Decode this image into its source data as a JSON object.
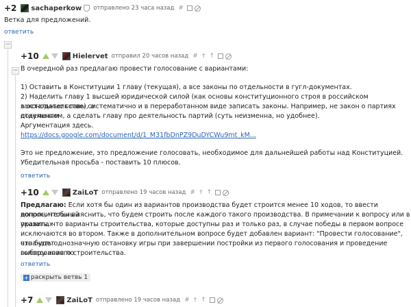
{
  "comments": [
    {
      "score": "+2",
      "author": "sachaperkow",
      "meta": "отправлено 23 часа назад",
      "body": "Ветка для предложений.",
      "reply": "ответить"
    },
    {
      "score": "+10",
      "author": "Hielervet",
      "meta": "отправил 20 часов назад",
      "lines": [
        "В очередной раз предлагаю провести голосование с вариантами:",
        "1) Оставить в Конституции 1 главу (текущая), а все законы по отдельности в гугл-документах.",
        "2) Наделить главу 1 высшей юридической силой (как основы конституционного строя в российском законодательстве), а",
        "в остальные главы систематично и в переработанном виде записать законы. Например, не закон о партиях отдельным",
        "документом, а сделать главу про деятельность партий (суть неизменна, но удобнее).",
        "Аргументация здесь.",
        "Это не предложение, это предложение голосовать, необходимое для дальнейшей работы над Конституцией.",
        "Убедительная просьба - поставить 10 плюсов."
      ],
      "link": "https://docs.google.com/document/d/1_M31fbDnPZ9DuDYCWu9mt_kM...",
      "reply": "ответить"
    },
    {
      "score": "+10",
      "author": "ZaiLoT",
      "meta": "отправлено 19 часов назад",
      "lead": "Предлагаю:",
      "lines": [
        " Если хотя бы один из вариантов производства будет строится менее 10 ходов, то ввести дополнительный",
        "вопрос, чтобы выяснить, что будем строить после каждого такого производства. В примечании к вопросу или в правилах",
        "указать, что варианты строительства, которые доступны раз и только раз, в случае победы в первом вопросе",
        "исключаются во втором. Также в дополнительном вопросе будет добавлен вариант: \"Провести голосование\", что будет",
        "означать однозначную остановку игры при завершении постройки из первого голосования и проведение голосования по",
        "выбору нового строительства."
      ],
      "reply": "ответить",
      "expand": "раскрыть ветвь 1"
    },
    {
      "score": "+7",
      "author": "ZaiLoT",
      "meta": "отправлено 19 часов назад"
    }
  ],
  "icons": {
    "hash": "#",
    "dagger": "†",
    "up": "↑",
    "collapse": "−"
  }
}
